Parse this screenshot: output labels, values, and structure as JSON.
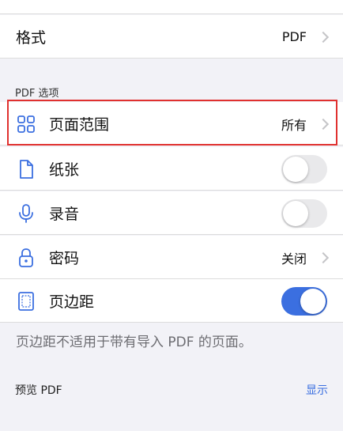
{
  "format_row": {
    "label": "格式",
    "value": "PDF"
  },
  "pdf_section": {
    "header": "PDF 选项"
  },
  "rows": {
    "page_range": {
      "label": "页面范围",
      "value": "所有",
      "icon": "grid-icon"
    },
    "paper": {
      "label": "纸张",
      "icon": "document-icon",
      "toggle_on": false
    },
    "audio": {
      "label": "录音",
      "icon": "microphone-icon",
      "toggle_on": false
    },
    "password": {
      "label": "密码",
      "value": "关闭",
      "icon": "lock-icon"
    },
    "margins": {
      "label": "页边距",
      "icon": "page-margin-icon",
      "toggle_on": true
    }
  },
  "margins_note": "页边距不适用于带有导入 PDF 的页面。",
  "preview": {
    "title": "预览 PDF",
    "action": "显示"
  },
  "colors": {
    "accent": "#3b6fe0",
    "highlight": "#e0312f"
  }
}
